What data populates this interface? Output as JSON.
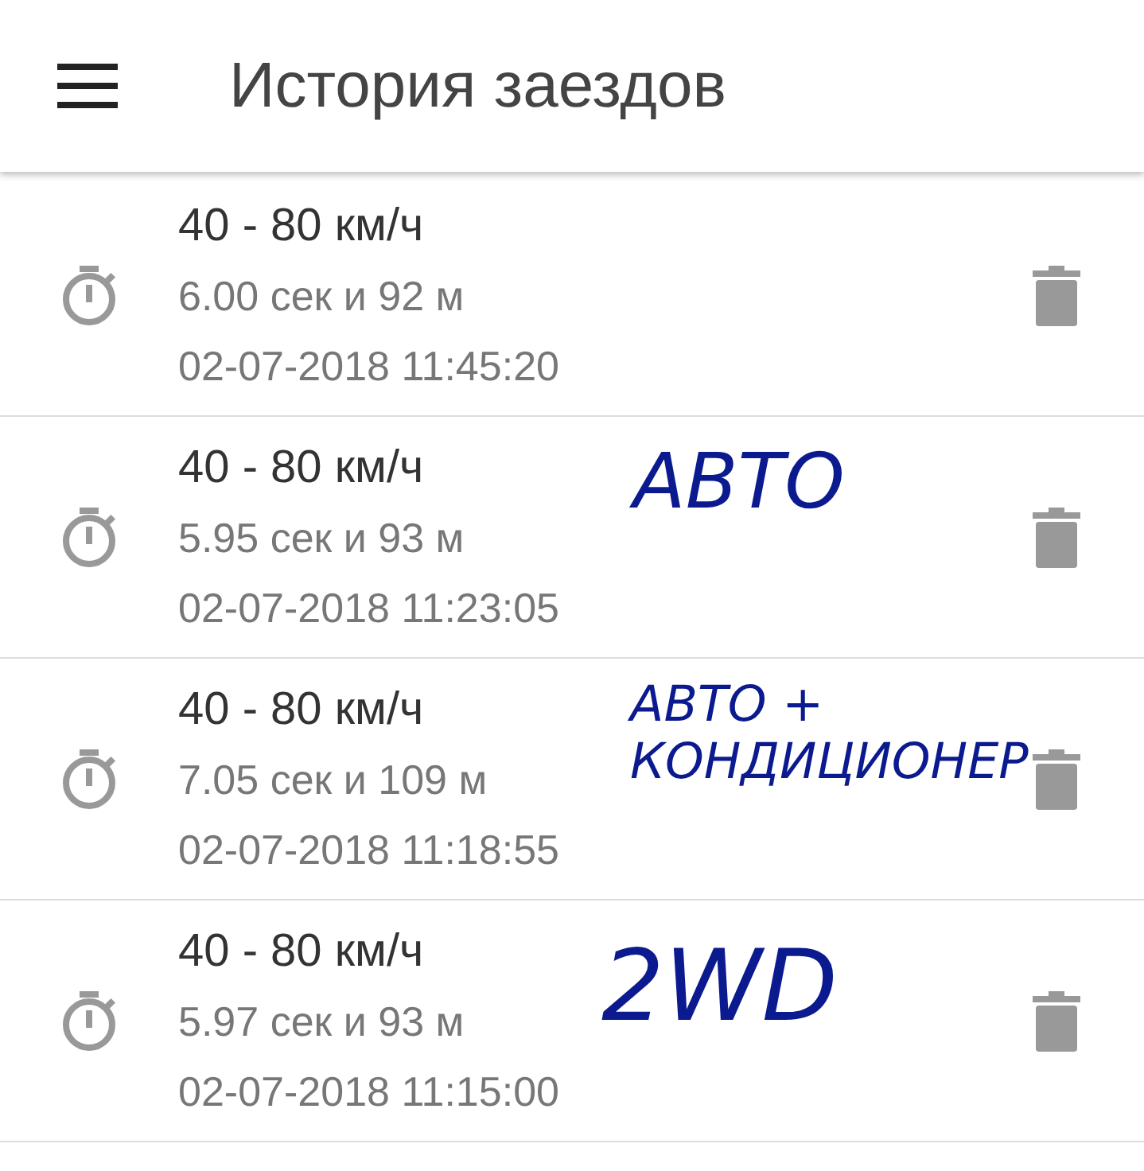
{
  "app_bar": {
    "title": "История заездов"
  },
  "runs": [
    {
      "title": "40 - 80 км/ч",
      "result": "6.00 сек и 92 м",
      "datetime": "02-07-2018 11:45:20"
    },
    {
      "title": "40 - 80 км/ч",
      "result": "5.95 сек и 93 м",
      "datetime": "02-07-2018 11:23:05",
      "note": [
        "АВТО"
      ]
    },
    {
      "title": "40 - 80 км/ч",
      "result": "7.05 сек и 109 м",
      "datetime": "02-07-2018 11:18:55",
      "note": [
        "АВТО +",
        "КОНДИЦИОНЕР"
      ]
    },
    {
      "title": "40 - 80 км/ч",
      "result": "5.97 сек и 93 м",
      "datetime": "02-07-2018 11:15:00",
      "note": [
        "2WD"
      ]
    }
  ]
}
